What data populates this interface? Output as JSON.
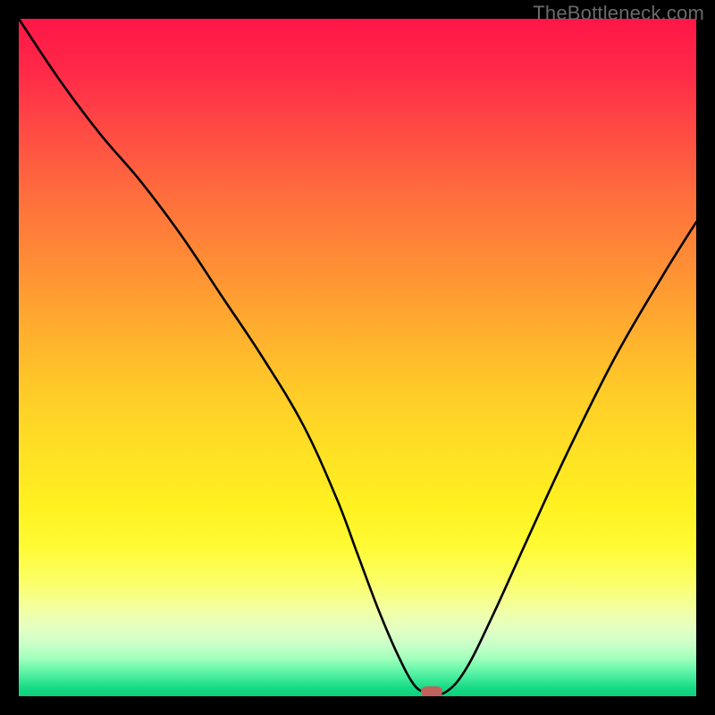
{
  "watermark": "TheBottleneck.com",
  "colors": {
    "page_bg": "#000000",
    "curve_stroke": "#000000",
    "marker_fill": "#c0615c",
    "watermark_text": "#6a6a6a"
  },
  "chart_data": {
    "type": "line",
    "title": "",
    "xlabel": "",
    "ylabel": "",
    "xlim": [
      0,
      100
    ],
    "ylim": [
      0,
      100
    ],
    "grid": false,
    "legend": false,
    "series": [
      {
        "name": "curve",
        "x": [
          0,
          6,
          12,
          18,
          24,
          30,
          36,
          42,
          47,
          50,
          53,
          56,
          58.5,
          60.5,
          63,
          66,
          70,
          75,
          81,
          88,
          95,
          100
        ],
        "y": [
          100,
          91,
          83,
          76,
          68,
          59,
          50,
          40,
          29,
          21,
          13,
          6,
          1.5,
          0.6,
          0.6,
          4,
          12,
          23,
          36,
          50,
          62,
          70
        ]
      }
    ],
    "flat_segment": {
      "x_start": 58.5,
      "x_end": 63,
      "y": 0.6
    },
    "marker": {
      "x": 61,
      "y": 0.6
    }
  }
}
